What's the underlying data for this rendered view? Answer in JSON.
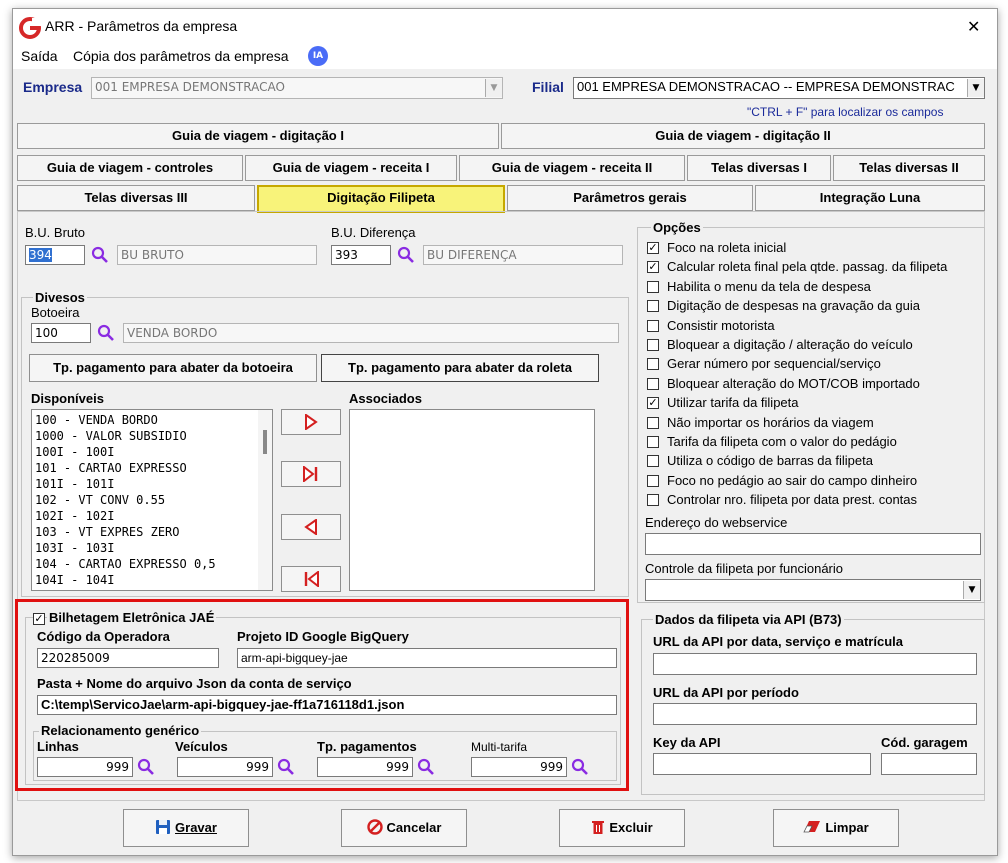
{
  "window": {
    "title": "ARR - Parâmetros da empresa",
    "close_glyph": "✕",
    "logo_letter": "G"
  },
  "menu": {
    "items": [
      "Saída",
      "Cópia dos parâmetros da empresa"
    ],
    "ia_badge": "IA"
  },
  "header": {
    "empresa_label": "Empresa",
    "empresa_value": "001 EMPRESA DEMONSTRACAO",
    "filial_label": "Filial",
    "filial_value": "001 EMPRESA DEMONSTRACAO -- EMPRESA DEMONSTRAC",
    "hint": "\"CTRL + F\" para localizar os campos"
  },
  "tabs": {
    "row1": [
      "Guia de viagem - digitação I",
      "Guia de viagem - digitação II"
    ],
    "row2": [
      "Guia de viagem - controles",
      "Guia de viagem - receita I",
      "Guia de viagem - receita II",
      "Telas diversas I",
      "Telas diversas II"
    ],
    "row3": [
      "Telas diversas III",
      "Digitação Filipeta",
      "Parâmetros gerais",
      "Integração Luna"
    ]
  },
  "bu": {
    "bruto_label": "B.U. Bruto",
    "bruto_code": "394",
    "bruto_desc": "BU BRUTO",
    "diferenca_label": "B.U. Diferença",
    "diferenca_code": "393",
    "diferenca_desc": "BU DIFERENÇA"
  },
  "diversos": {
    "title": "Divesos",
    "botoeira_label": "Botoeira",
    "botoeira_code": "100",
    "botoeira_desc": "VENDA BORDO",
    "btn_botoeira": "Tp. pagamento para abater da botoeira",
    "btn_roleta": "Tp. pagamento para abater da roleta",
    "disponiveis_label": "Disponíveis",
    "associados_label": "Associados",
    "disponiveis": [
      "100 - VENDA BORDO",
      "1000 - VALOR SUBSIDIO",
      "100I - 100I",
      "101 - CARTAO EXPRESSO",
      "101I - 101I",
      "102 - VT CONV 0.55",
      "102I - 102I",
      "103 - VT EXPRES ZERO",
      "103I - 103I",
      "104 - CARTAO EXPRESSO 0,5",
      "104I - 104I"
    ]
  },
  "bilhetagem": {
    "title": "Bilhetagem Eletrônica JAÉ",
    "checked": true,
    "codigo_label": "Código da Operadora",
    "codigo_value": "220285009",
    "projeto_label": "Projeto ID Google BigQuery",
    "projeto_value": "arm-api-bigquey-jae",
    "pasta_label": "Pasta + Nome do arquivo Json  da conta de serviço",
    "pasta_value": "C:\\temp\\ServicoJae\\arm-api-bigquey-jae-ff1a716118d1.json",
    "rel_title": "Relacionamento genérico",
    "linhas_label": "Linhas",
    "linhas_value": "999",
    "veiculos_label": "Veículos",
    "veiculos_value": "999",
    "tp_label": "Tp. pagamentos",
    "tp_value": "999",
    "multi_label": "Multi-tarifa",
    "multi_value": "999"
  },
  "opcoes": {
    "title": "Opções",
    "items": [
      {
        "label": "Foco na roleta inicial",
        "checked": true
      },
      {
        "label": "Calcular roleta final pela qtde. passag. da filipeta",
        "checked": true
      },
      {
        "label": "Habilita o menu da tela de despesa",
        "checked": false
      },
      {
        "label": "Digitação de despesas na gravação da guia",
        "checked": false
      },
      {
        "label": "Consistir motorista",
        "checked": false
      },
      {
        "label": "Bloquear a digitação / alteração do veículo",
        "checked": false
      },
      {
        "label": "Gerar número por sequencial/serviço",
        "checked": false
      },
      {
        "label": "Bloquear alteração do MOT/COB importado",
        "checked": false
      },
      {
        "label": "Utilizar tarifa da filipeta",
        "checked": true
      },
      {
        "label": "Não importar os horários da viagem",
        "checked": false
      },
      {
        "label": "Tarifa da filipeta com o valor do pedágio",
        "checked": false
      },
      {
        "label": "Utiliza o código de barras da filipeta",
        "checked": false
      },
      {
        "label": "Foco no pedágio ao sair do campo dinheiro",
        "checked": false
      },
      {
        "label": "Controlar nro. filipeta por data prest. contas",
        "checked": false
      }
    ],
    "webservice_label": "Endereço do webservice",
    "controle_label": "Controle da filipeta por funcionário"
  },
  "api": {
    "title": "Dados da filipeta via API (B73)",
    "url_data_label": "URL da API por data, serviço e matrícula",
    "url_periodo_label": "URL da API por período",
    "key_label": "Key da API",
    "garagem_label": "Cód. garagem"
  },
  "footer": {
    "gravar": "Gravar",
    "cancelar": "Cancelar",
    "excluir": "Excluir",
    "limpar": "Limpar"
  },
  "colors": {
    "highlight_border": "#e01010",
    "active_tab": "#f8f37a",
    "magnifier": "#8a2be2",
    "logo": "#d62828",
    "ia_badge": "#4a6cf7"
  }
}
